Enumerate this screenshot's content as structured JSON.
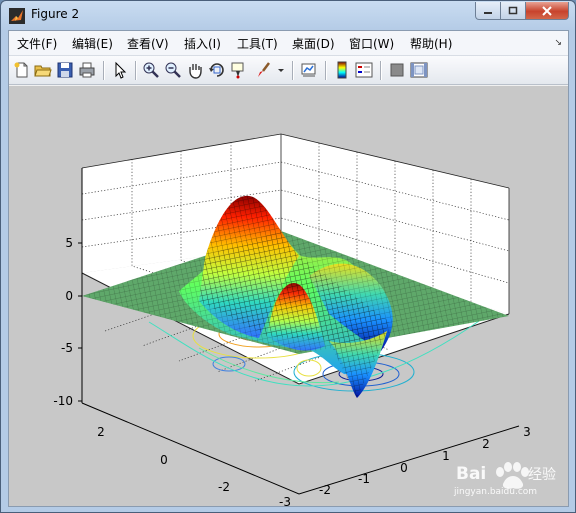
{
  "window": {
    "title": "Figure 2"
  },
  "menu": [
    {
      "label": "文件(F)",
      "name": "menu-file"
    },
    {
      "label": "编辑(E)",
      "name": "menu-edit"
    },
    {
      "label": "查看(V)",
      "name": "menu-view"
    },
    {
      "label": "插入(I)",
      "name": "menu-insert"
    },
    {
      "label": "工具(T)",
      "name": "menu-tools"
    },
    {
      "label": "桌面(D)",
      "name": "menu-desktop"
    },
    {
      "label": "窗口(W)",
      "name": "menu-window"
    },
    {
      "label": "帮助(H)",
      "name": "menu-help"
    }
  ],
  "toolbar": [
    "new-figure-icon",
    "open-file-icon",
    "save-icon",
    "print-icon",
    "edit-plot-arrow-icon",
    "zoom-in-icon",
    "zoom-out-icon",
    "pan-hand-icon",
    "rotate-3d-icon",
    "data-cursor-icon",
    "brush-icon",
    "brush-dropdown-icon",
    "link-plot-icon",
    "colorbar-icon",
    "legend-icon",
    "hide-plot-tools-icon",
    "show-plot-tools-icon"
  ],
  "axes": {
    "z_ticks": [
      "5",
      "0",
      "-5",
      "-10"
    ],
    "y_ticks": [
      "2",
      "0",
      "-2"
    ],
    "x_ticks": [
      "-3",
      "-2",
      "-1",
      "0",
      "1",
      "2",
      "3"
    ]
  },
  "watermark": {
    "brand": "Bai",
    "brand2": "经验",
    "url": "jingyan.baidu.com"
  }
}
